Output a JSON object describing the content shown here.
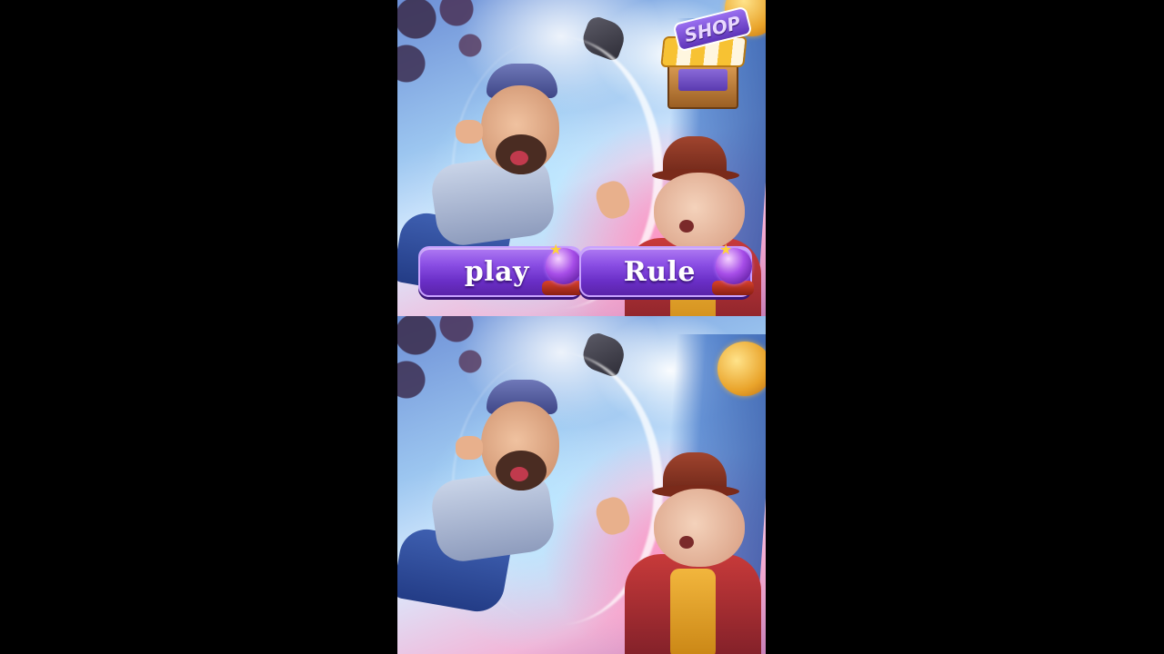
{
  "game": {
    "buttons": {
      "play_label": "play",
      "rule_label": "Rule"
    },
    "shop": {
      "sign_label": "SHOP"
    },
    "icons": [
      "orb-icon",
      "shop-icon",
      "coin-icon"
    ],
    "colors": {
      "button_purple": "#8a4ee4",
      "button_border": "#c8a2ff",
      "letterbox": "#000000",
      "shop_awning_yellow": "#f7c233"
    }
  }
}
